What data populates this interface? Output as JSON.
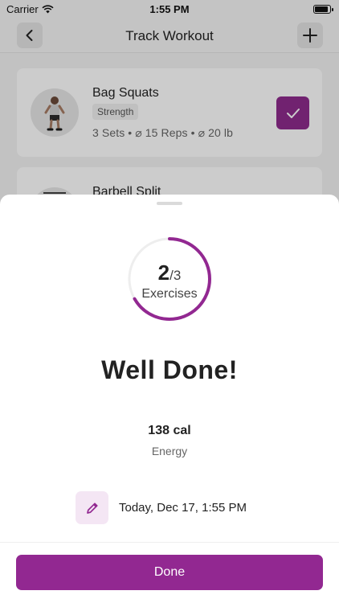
{
  "status_bar": {
    "carrier": "Carrier",
    "time": "1:55 PM"
  },
  "nav": {
    "title": "Track Workout",
    "back_icon": "chevron-left-icon",
    "add_icon": "plus-icon"
  },
  "exercises": [
    {
      "name": "Bag Squats",
      "tag": "Strength",
      "meta": "3 Sets • ⌀ 15 Reps • ⌀ 20 lb",
      "completed": true
    },
    {
      "name": "Barbell Split"
    }
  ],
  "summary": {
    "completed": "2",
    "total": "/3",
    "progress_fraction": 0.6667,
    "ring_label": "Exercises",
    "heading": "Well Done!",
    "energy_value": "138 cal",
    "energy_label": "Energy",
    "date": "Today, Dec 17, 1:55 PM",
    "edit_icon": "pencil-icon",
    "done_label": "Done"
  },
  "colors": {
    "accent": "#922891",
    "accent_light": "#f4e6f4"
  }
}
